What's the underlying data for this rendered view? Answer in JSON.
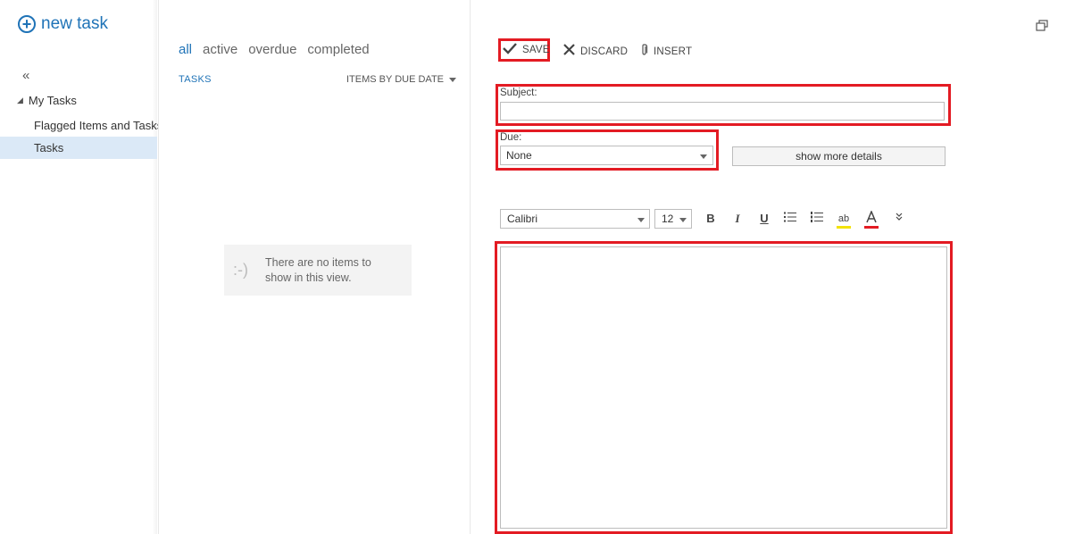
{
  "new_task": {
    "label": "new task"
  },
  "nav": {
    "collapse_glyph": "«",
    "group": {
      "label": "My Tasks"
    },
    "items": [
      {
        "label": "Flagged Items and Tasks"
      },
      {
        "label": "Tasks",
        "selected": true
      }
    ]
  },
  "filters": [
    "all",
    "active",
    "overdue",
    "completed"
  ],
  "list": {
    "header": "TASKS",
    "sort_label": "ITEMS BY DUE DATE",
    "empty_face": ":-)",
    "empty_text": "There are no items to show in this view."
  },
  "toolbar": {
    "save": "SAVE",
    "discard": "DISCARD",
    "insert": "INSERT"
  },
  "form": {
    "subject_label": "Subject:",
    "subject_value": "",
    "due_label": "Due:",
    "due_value": "None",
    "more_details": "show more details"
  },
  "format": {
    "font": "Calibri",
    "size": "12",
    "bold": "B",
    "italic": "I",
    "underline": "U",
    "highlight": "ab"
  },
  "colors": {
    "accent": "#1f73b7",
    "highlight_box": "#e31b23",
    "selected_nav": "#dbe9f7"
  },
  "icons": [
    "plus-circle-icon",
    "collapse-icon",
    "caret-icon",
    "checkmark-icon",
    "x-icon",
    "paperclip-icon",
    "bullet-list-icon",
    "numbered-list-icon",
    "highlight-icon",
    "font-color-icon",
    "more-formatting-icon",
    "popout-icon"
  ]
}
